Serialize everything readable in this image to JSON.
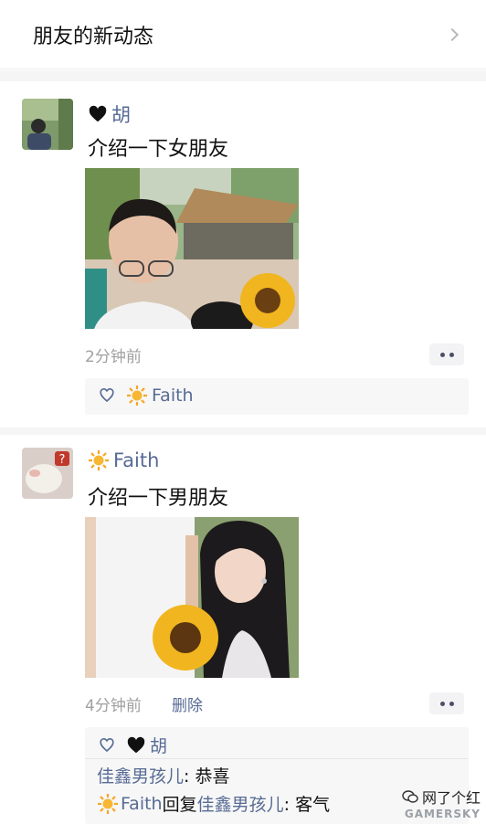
{
  "header": {
    "title": "朋友的新动态"
  },
  "posts": [
    {
      "author": "胡",
      "text": "介绍一下女朋友",
      "time": "2分钟前",
      "likes": [
        "Faith"
      ]
    },
    {
      "author": "Faith",
      "text": "介绍一下男朋友",
      "time": "4分钟前",
      "delete_label": "删除",
      "likes": [
        "胡"
      ],
      "comments": [
        {
          "name": "佳鑫男孩儿",
          "text": ": 恭喜"
        },
        {
          "name": "Faith",
          "reply_word": "回复",
          "reply_to": "佳鑫男孩儿",
          "text": ": 客气"
        }
      ]
    }
  ],
  "watermark": {
    "top": "网了个红",
    "bottom": "GAMERSKY"
  },
  "colors": {
    "link": "#576b95",
    "meta": "#a0a0a0",
    "gap": "#f5f5f5"
  },
  "icons": [
    "chevron-right-icon",
    "black-heart-icon",
    "sun-icon",
    "heart-outline-icon",
    "more-dots-icon"
  ]
}
